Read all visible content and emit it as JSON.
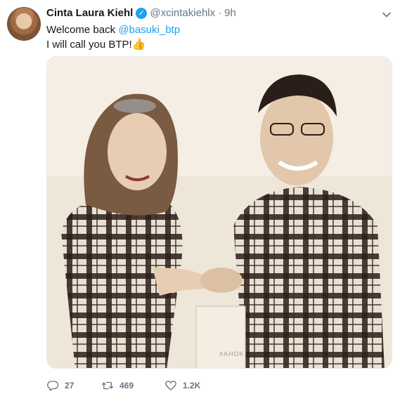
{
  "tweet": {
    "display_name": "Cinta Laura Kiehl",
    "handle": "@xcintakiehlx",
    "separator": "·",
    "timestamp": "9h",
    "text_line1_prefix": "Welcome back ",
    "mention": "@basuki_btp",
    "text_line2": "I will call you BTP!",
    "emoji": "👍",
    "photo_watermark": "#AHOK",
    "counts": {
      "replies": "27",
      "retweets": "469",
      "likes": "1.2K"
    }
  },
  "icons": {
    "verified": "verified-badge-icon",
    "caret": "chevron-down-icon",
    "reply": "reply-icon",
    "retweet": "retweet-icon",
    "like": "heart-icon"
  },
  "colors": {
    "accent": "#1da1f2",
    "muted": "#657786",
    "text": "#14171a"
  }
}
